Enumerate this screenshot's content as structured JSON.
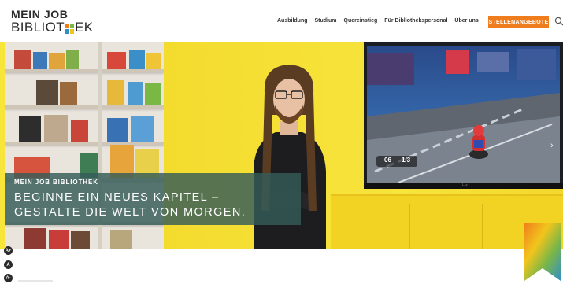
{
  "logo": {
    "line1": "MEIN JOB",
    "line2_pre": "BIBLIOT",
    "line2_post": "EK"
  },
  "nav": {
    "items": [
      {
        "label": "Ausbildung"
      },
      {
        "label": "Studium"
      },
      {
        "label": "Quereinstieg"
      },
      {
        "label": "Für Bibliothekspersonal"
      },
      {
        "label": "Über uns"
      }
    ],
    "cta": "STELLENANGEBOTE",
    "search_icon": "search-icon"
  },
  "hero": {
    "eyebrow": "MEIN JOB BIBLIOTHEK",
    "title_line1": "BEGINNE EIN NEUES KAPITEL –",
    "title_line2": "GESTALTE DIE WELT VON MORGEN.",
    "tv": {
      "hud_left": "06",
      "hud_right": "1/3",
      "brand": "LG"
    },
    "next_icon": "chevron-right-icon"
  },
  "accessibility": {
    "increase": "A+",
    "normal": "A",
    "decrease": "A-"
  },
  "colors": {
    "accent": "#f07d1d",
    "overlay": "#345c58",
    "yellow": "#f7e43c"
  }
}
